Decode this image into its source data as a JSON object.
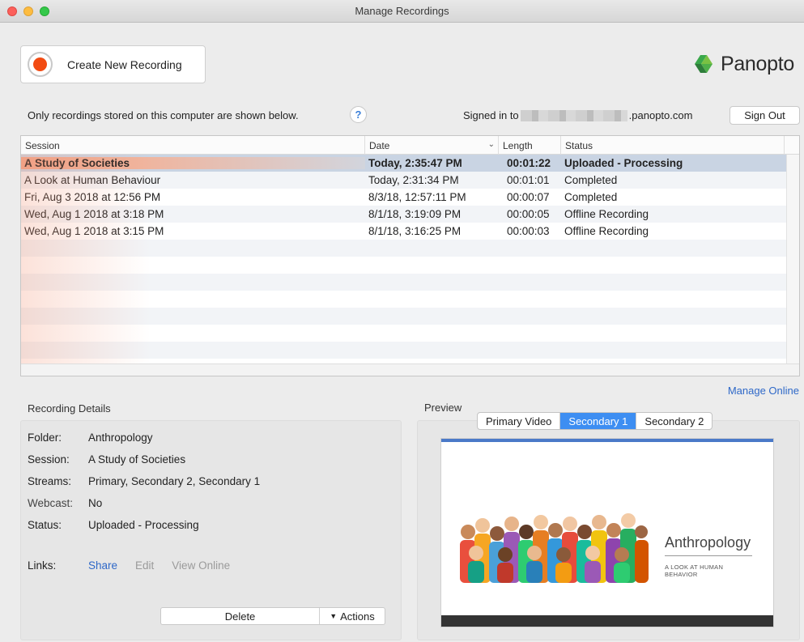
{
  "window": {
    "title": "Manage Recordings"
  },
  "toolbar": {
    "create_label": "Create New Recording"
  },
  "brand": {
    "name": "Panopto"
  },
  "info": {
    "stored_text": "Only recordings stored on this computer are shown below.",
    "help_glyph": "?",
    "signed_in_prefix": "Signed in to",
    "signed_in_suffix": ".panopto.com",
    "sign_out_label": "Sign Out"
  },
  "table": {
    "columns": [
      "Session",
      "Date",
      "Length",
      "Status"
    ],
    "rows": [
      {
        "session": "A Study of Societies",
        "date": "Today, 2:35:47 PM",
        "length": "00:01:22",
        "status": "Uploaded - Processing"
      },
      {
        "session": "A Look at Human Behaviour",
        "date": "Today, 2:31:34 PM",
        "length": "00:01:01",
        "status": "Completed"
      },
      {
        "session": "Fri, Aug 3 2018 at 12:56 PM",
        "date": "8/3/18, 12:57:11 PM",
        "length": "00:00:07",
        "status": "Completed"
      },
      {
        "session": "Wed, Aug 1 2018 at 3:18 PM",
        "date": "8/1/18, 3:19:09 PM",
        "length": "00:00:05",
        "status": "Offline Recording"
      },
      {
        "session": "Wed, Aug 1 2018 at 3:15 PM",
        "date": "8/1/18, 3:16:25 PM",
        "length": "00:00:03",
        "status": "Offline Recording"
      }
    ],
    "manage_online_label": "Manage Online"
  },
  "details": {
    "title": "Recording Details",
    "folder_label": "Folder:",
    "folder_value": "Anthropology",
    "session_label": "Session:",
    "session_value": "A Study of Societies",
    "streams_label": "Streams:",
    "streams_value": "Primary, Secondary 2, Secondary 1",
    "webcast_label": "Webcast:",
    "webcast_value": "No",
    "status_label": "Status:",
    "status_value": "Uploaded - Processing",
    "links_label": "Links:",
    "link_share": "Share",
    "link_edit": "Edit",
    "link_view_online": "View Online",
    "delete_label": "Delete",
    "actions_label": "Actions"
  },
  "preview": {
    "title": "Preview",
    "tabs": [
      "Primary Video",
      "Secondary 1",
      "Secondary 2"
    ],
    "active_tab": "Secondary 1",
    "slide_title": "Anthropology",
    "slide_subtitle": "A LOOK AT HUMAN BEHAVIOR"
  },
  "colors": {
    "accent": "#3d8ef2",
    "record": "#f24b12",
    "link": "#2e68c8"
  }
}
